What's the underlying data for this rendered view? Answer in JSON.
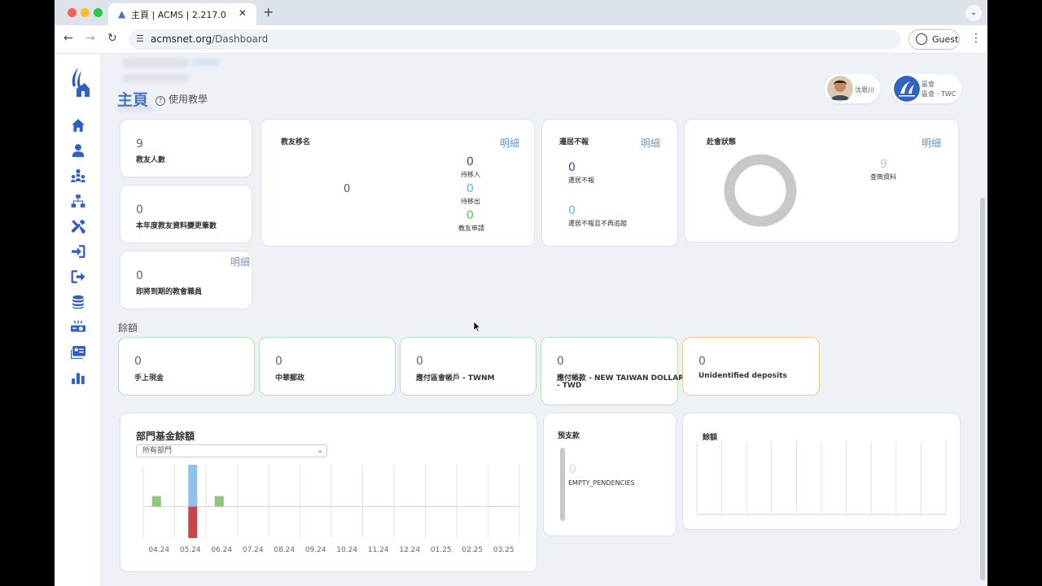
{
  "browser": {
    "tab_title": "主頁 | ACMS | 2.217.0",
    "url_host": "acmsnet.org",
    "url_path": "/Dashboard",
    "profile_label": "Guest",
    "traffic_colors": [
      "#ff5f57",
      "#febc2e",
      "#28c840"
    ]
  },
  "page": {
    "title": "主頁",
    "help_label": "使用教學"
  },
  "users": [
    {
      "name": "沈恩川"
    },
    {
      "name": "區會",
      "sub": "區會 - TWC"
    }
  ],
  "sidebar": {
    "icons": [
      "home-icon",
      "user-icon",
      "org-chart-icon",
      "sitemap-icon",
      "tools-icon",
      "sign-in-icon",
      "sign-out-icon",
      "coins-icon",
      "projector-icon",
      "id-card-icon",
      "bar-chart-icon"
    ]
  },
  "cards": {
    "members": {
      "value": "9",
      "label": "教友人數"
    },
    "changes": {
      "value": "0",
      "label": "本年度教友資料變更筆數"
    },
    "expiring": {
      "value": "0",
      "label": "即將到期的教會職員",
      "detail": "明細"
    },
    "transfer": {
      "title": "教友移名",
      "detail": "明細",
      "total": "0",
      "in_value": "0",
      "in_label": "待移入",
      "out_value": "0",
      "out_label": "待移出",
      "apply_value": "0",
      "apply_label": "教友申請"
    },
    "moved": {
      "title": "遷居不報",
      "detail": "明細",
      "a_value": "0",
      "a_label": "遷居不報",
      "b_value": "0",
      "b_label": "遷居不報且不再追蹤"
    },
    "attendance": {
      "title": "赴會狀態",
      "detail": "明細",
      "value": "9",
      "label": "查無資料"
    }
  },
  "balances": {
    "title": "餘額",
    "items": [
      {
        "value": "0",
        "label": "手上現金",
        "color": "#b9dfb9"
      },
      {
        "value": "0",
        "label": "中華郵政",
        "color": "#b9dfb9"
      },
      {
        "value": "0",
        "label": "應付區會帳戶 - TWNM",
        "color": "#b9dfb9"
      },
      {
        "value": "0",
        "label_1": "應付帳款 - NEW TAIWAN DOLLAR",
        "label_2": "- TWD",
        "color": "#b9dfb9"
      },
      {
        "value": "0",
        "label": "Unidentified deposits",
        "color": "#f0c98a"
      }
    ]
  },
  "dept_chart": {
    "title": "部門基金餘額",
    "select_value": "所有部門"
  },
  "chart_data": [
    {
      "type": "bar",
      "title": "部門基金餘額",
      "categories": [
        "04.24",
        "05.24",
        "06.24",
        "07.24",
        "08.24",
        "09.24",
        "10.24",
        "11.24",
        "12.24",
        "01.25",
        "02.25",
        "03.25"
      ],
      "series": [
        {
          "color": "#93c47d",
          "values": [
            1,
            0,
            1,
            0,
            0,
            0,
            0,
            0,
            0,
            0,
            0,
            0
          ]
        },
        {
          "color": "#cc4444",
          "values": [
            0,
            -3,
            0,
            0,
            0,
            0,
            0,
            0,
            0,
            0,
            0,
            0
          ]
        },
        {
          "color": "#8ec0f0",
          "values": [
            0,
            4,
            0,
            0,
            0,
            0,
            0,
            0,
            0,
            0,
            0,
            0
          ]
        }
      ],
      "ylim": [
        -3,
        4
      ],
      "grid": true
    }
  ],
  "pending": {
    "title": "預支款",
    "value": "0",
    "label": "EMPTY_PENDENCIES"
  },
  "balance_chart": {
    "title": "餘額"
  }
}
